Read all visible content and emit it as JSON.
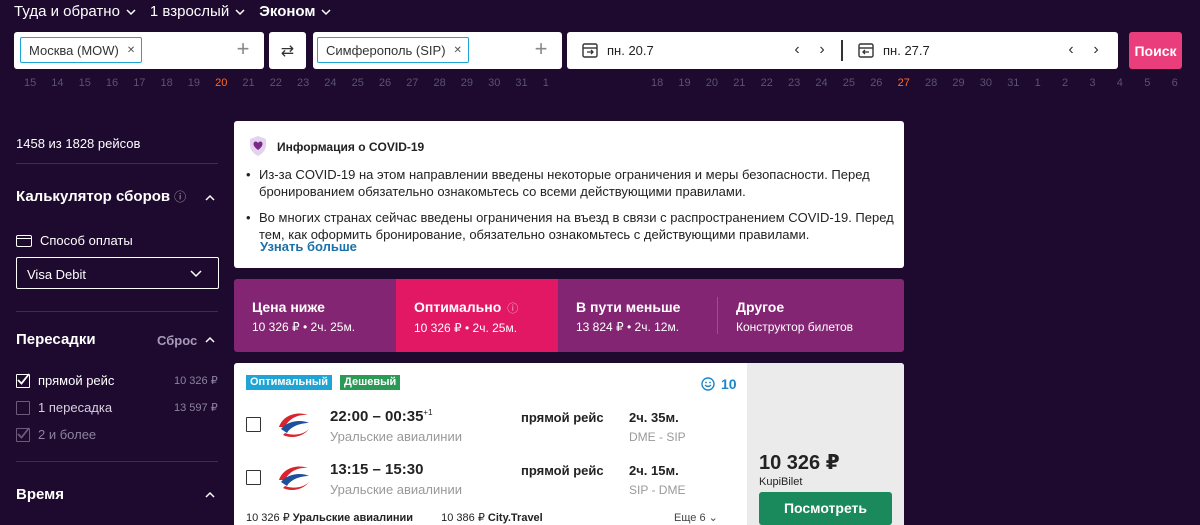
{
  "trip": {
    "type_label": "Туда и обратно",
    "passengers_label": "1 взрослый",
    "class_label": "Эконом"
  },
  "search": {
    "origin_chip": "Москва (MOW)",
    "destination_chip": "Симферополь (SIP)",
    "depart_date": "пн. 20.7",
    "return_date": "пн. 27.7",
    "search_button": "Поиск"
  },
  "calendar": {
    "depart_days": [
      "15",
      "14",
      "15",
      "16",
      "17",
      "18",
      "19",
      "20",
      "21",
      "22",
      "23",
      "24",
      "25",
      "26",
      "27",
      "28",
      "29",
      "30",
      "31",
      "1"
    ],
    "return_days": [
      "18",
      "19",
      "20",
      "21",
      "22",
      "23",
      "24",
      "25",
      "26",
      "27",
      "28",
      "29",
      "30",
      "31",
      "1",
      "2",
      "3",
      "4",
      "5",
      "6"
    ],
    "highlight_color": "#ff6a2a"
  },
  "sidebar": {
    "results_count": "1458 из 1828 рейсов",
    "fees_title": "Калькулятор сборов",
    "payment_label": "Способ оплаты",
    "payment_value": "Visa Debit",
    "transfers_title": "Пересадки",
    "reset_label": "Сброс",
    "transfers": [
      {
        "label": "прямой рейс",
        "price": "10 326 ₽",
        "checked": true
      },
      {
        "label": "1 пересадка",
        "price": "13 597 ₽",
        "checked": false
      },
      {
        "label": "2 и более",
        "price": "",
        "checked": true
      }
    ],
    "time_title": "Время"
  },
  "covid": {
    "title": "Информация о COVID-19",
    "bullets": [
      "Из-за COVID-19 на этом направлении введены некоторые ограничения и меры безопасности. Перед бронированием обязательно ознакомьтесь со всеми действующими правилами.",
      "Во многих странах сейчас введены ограничения на въезд в связи с распространением COVID-19. Перед тем, как оформить бронирование, обязательно ознакомьтесь с действующими правилами."
    ],
    "more_link": "Узнать больше"
  },
  "sort_tabs": [
    {
      "label": "Цена ниже",
      "sub": "10 326 ₽ • 2ч. 25м."
    },
    {
      "label": "Оптимально",
      "sub": "10 326 ₽ • 2ч. 25м."
    },
    {
      "label": "В пути меньше",
      "sub": "13 824 ₽ • 2ч. 12м."
    },
    {
      "label": "Другое",
      "sub": "Конструктор билетов"
    }
  ],
  "result": {
    "badge_optimal": "Оптимальный",
    "badge_cheap": "Дешевый",
    "rating": "10",
    "segments": [
      {
        "time": "22:00 – 00:35",
        "next_day": "+1",
        "airline": "Уральские авиалинии",
        "direct": "прямой рейс",
        "duration": "2ч. 35м.",
        "route": "DME - SIP"
      },
      {
        "time": "13:15 – 15:30",
        "next_day": "",
        "airline": "Уральские авиалинии",
        "direct": "прямой рейс",
        "duration": "2ч. 15м.",
        "route": "SIP - DME"
      }
    ],
    "offer1_price": "10 326 ₽",
    "offer1_agency": "Уральские авиалинии",
    "offer2_price": "10 386 ₽",
    "offer2_agency": "City.Travel",
    "more_offers": "Еще 6",
    "price": "10 326 ₽",
    "agency": "KupiBilet",
    "view_button": "Посмотреть"
  },
  "colors": {
    "bg": "#1d0a2e",
    "accent_pink": "#e21865",
    "tabs_purple": "#842573",
    "search_pink": "#ea3d7b",
    "view_green": "#1a8a5c",
    "badge_blue": "#1ea5d6",
    "badge_green": "#2a9a55"
  }
}
